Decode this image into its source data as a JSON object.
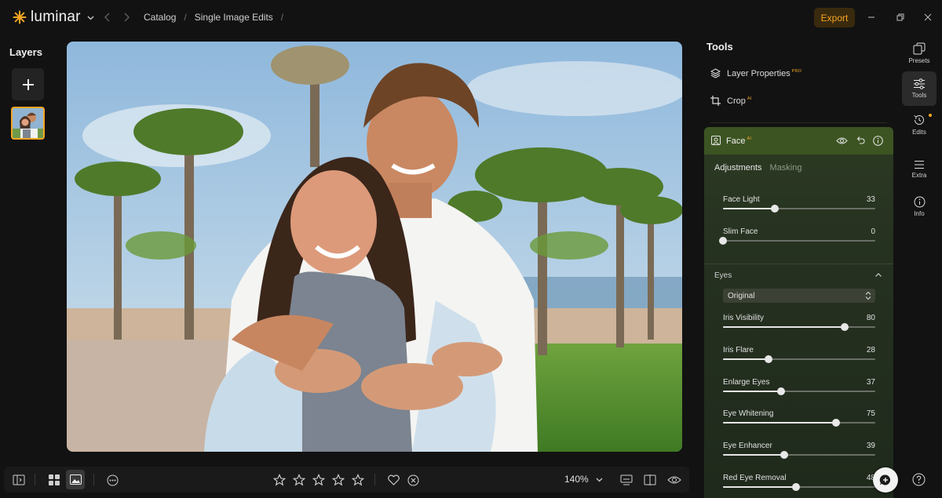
{
  "app": {
    "logo_text": "luminar",
    "accent": "#f5a623"
  },
  "breadcrumb": {
    "items": [
      "Catalog",
      "Single Image Edits"
    ],
    "separator": "/"
  },
  "header": {
    "export_label": "Export"
  },
  "layers": {
    "title": "Layers",
    "add_icon": "plus-icon"
  },
  "canvas": {
    "description_icon": "photo-couple"
  },
  "bottom_toolbar": {
    "zoom_label": "140%",
    "rating_stars": 5,
    "rating_value": 0
  },
  "tools": {
    "title": "Tools",
    "layer_properties": {
      "label": "Layer Properties",
      "badge": "PRO"
    },
    "crop": {
      "label": "Crop",
      "badge": "AI"
    },
    "face": {
      "label": "Face",
      "badge": "AI",
      "tabs": [
        "Adjustments",
        "Masking"
      ],
      "sliders": [
        {
          "label": "Face Light",
          "value": 33,
          "fraction": 0.34
        },
        {
          "label": "Slim Face",
          "value": 0,
          "fraction": 0.0
        }
      ],
      "eyes": {
        "title": "Eyes",
        "preset": "Original",
        "sliders": [
          {
            "label": "Iris Visibility",
            "value": 80,
            "fraction": 0.8
          },
          {
            "label": "Iris Flare",
            "value": 28,
            "fraction": 0.3
          },
          {
            "label": "Enlarge Eyes",
            "value": 37,
            "fraction": 0.38
          },
          {
            "label": "Eye Whitening",
            "value": 75,
            "fraction": 0.74
          },
          {
            "label": "Eye Enhancer",
            "value": 39,
            "fraction": 0.4
          },
          {
            "label": "Red Eye Removal",
            "value": 48,
            "fraction": 0.48
          }
        ]
      }
    }
  },
  "rail": {
    "items": [
      {
        "label": "Presets",
        "icon": "presets-icon"
      },
      {
        "label": "Tools",
        "icon": "sliders-icon"
      },
      {
        "label": "Edits",
        "icon": "history-icon"
      },
      {
        "label": "Extra",
        "icon": "list-icon"
      },
      {
        "label": "Info",
        "icon": "info-icon"
      }
    ]
  }
}
